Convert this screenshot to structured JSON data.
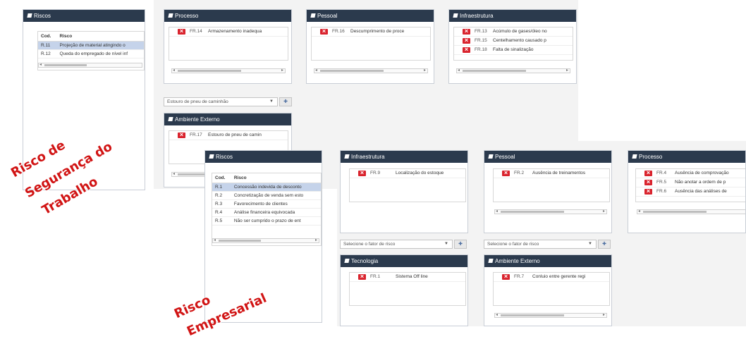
{
  "seg": {
    "riscos": {
      "title": "Riscos",
      "col_cod": "Cod.",
      "col_risco": "Risco",
      "rows": [
        {
          "cod": "R.11",
          "risco": "Projeção de material atingindo o"
        },
        {
          "cod": "R.12",
          "risco": "Queda do empregado de nível inf"
        }
      ]
    },
    "processo": {
      "title": "Processo",
      "items": [
        {
          "code": "FR.14",
          "text": "Armazenamento inadequa"
        }
      ]
    },
    "pessoal": {
      "title": "Pessoal",
      "items": [
        {
          "code": "FR.16",
          "text": "Descumprimento de proce"
        }
      ]
    },
    "infra": {
      "title": "Infraestrutura",
      "items": [
        {
          "code": "FR.13",
          "text": "Acúmulo de gases/óleo no"
        },
        {
          "code": "FR.15",
          "text": "Centelhamento causado p"
        },
        {
          "code": "FR.18",
          "text": "Falta de sinalização"
        }
      ]
    },
    "select_value": "Estouro de pneu de caminhão",
    "ambiente": {
      "title": "Ambiente Externo",
      "items": [
        {
          "code": "FR.17",
          "text": "Estouro de pneu de camin"
        }
      ]
    },
    "label_line1": "Risco de",
    "label_line2": "Segurança do",
    "label_line3": "Trabalho"
  },
  "emp": {
    "riscos": {
      "title": "Riscos",
      "col_cod": "Cod.",
      "col_risco": "Risco",
      "rows": [
        {
          "cod": "R.1",
          "risco": "Concessão indevida de desconto"
        },
        {
          "cod": "R.2",
          "risco": "Concretização de venda sem esto"
        },
        {
          "cod": "R.3",
          "risco": "Favorecimento de clientes"
        },
        {
          "cod": "R.4",
          "risco": "Análise financeira equivocada"
        },
        {
          "cod": "R.5",
          "risco": "Não ser cumprido o prazo de ent"
        }
      ]
    },
    "infra": {
      "title": "Infraestrutura",
      "items": [
        {
          "code": "FR.9",
          "text": "Localização do estoque"
        }
      ]
    },
    "pessoal": {
      "title": "Pessoal",
      "items": [
        {
          "code": "FR.2",
          "text": "Ausência de treinamentos"
        }
      ]
    },
    "processo": {
      "title": "Processo",
      "items": [
        {
          "code": "FR.4",
          "text": "Ausência de comprovação"
        },
        {
          "code": "FR.5",
          "text": "Não anotar a ordem de p"
        },
        {
          "code": "FR.6",
          "text": "Ausência das análises de"
        }
      ]
    },
    "select_placeholder_1": "Selecione o fator de risco",
    "select_placeholder_2": "Selecione o fator de risco",
    "tecnologia": {
      "title": "Tecnologia",
      "items": [
        {
          "code": "FR.1",
          "text": "Sistema Off line"
        }
      ]
    },
    "ambiente": {
      "title": "Ambiente Externo",
      "items": [
        {
          "code": "FR.7",
          "text": "Conluio entre gerente regi"
        }
      ]
    },
    "label_line1": "Risco",
    "label_line2": "Empresarial"
  },
  "icons": {
    "add": "plus-icon",
    "remove": "close-icon",
    "panel": "book-icon",
    "dropdown": "caret-down-icon"
  },
  "colors": {
    "header": "#2b3a4d",
    "remove_button": "#d9232d",
    "selected_row": "#c5d3ea",
    "label": "#d11414"
  }
}
